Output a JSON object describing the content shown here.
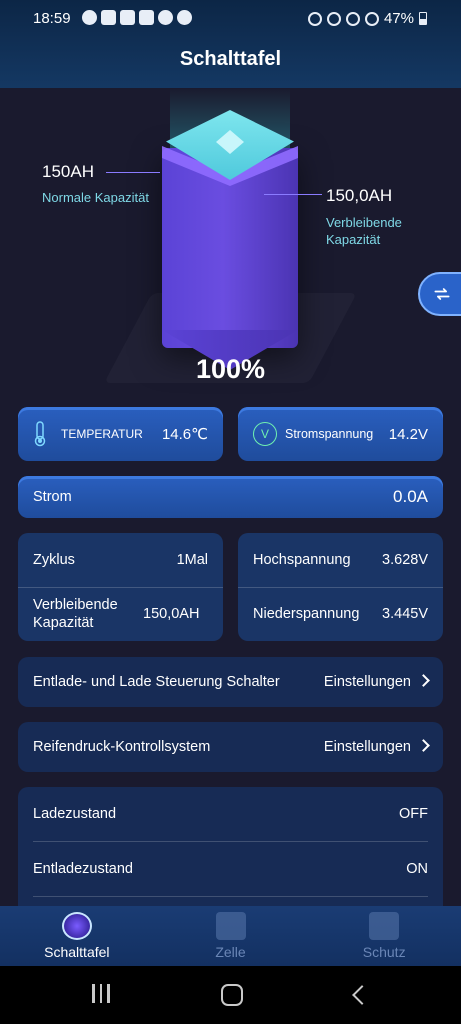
{
  "status_bar": {
    "time": "18:59",
    "battery_percent": "47%",
    "icons": [
      "whatsapp-icon",
      "youtube-icon",
      "mail-icon",
      "youtube-icon",
      "triangle-icon",
      "triangle-icon",
      "alarm-icon",
      "mute-icon",
      "wifi-icon",
      "signal-icon"
    ]
  },
  "header": {
    "title": "Schalttafel"
  },
  "battery_visual": {
    "normal_capacity_value": "150AH",
    "normal_capacity_label": "Normale Kapazität",
    "remaining_capacity_value": "150,0AH",
    "remaining_capacity_label": "Verbleibende Kapazität",
    "percent": "100%"
  },
  "metrics": {
    "temperature_label": "TEMPERATUR",
    "temperature_value": "14.6℃",
    "voltage_label": "Stromspannung",
    "voltage_value": "14.2V",
    "current_label": "Strom",
    "current_value": "0.0A"
  },
  "stats": {
    "cycle_label": "Zyklus",
    "cycle_value": "1Mal",
    "remaining_label": "Verbleibende Kapazität",
    "remaining_value": "150,0AH",
    "high_voltage_label": "Hochspannung",
    "high_voltage_value": "3.628V",
    "low_voltage_label": "Niederspannung",
    "low_voltage_value": "3.445V"
  },
  "settings": {
    "discharge_charge_label": "Entlade- und Lade Steuerung Schalter",
    "discharge_charge_action": "Einstellungen",
    "tire_pressure_label": "Reifendruck-Kontrollsystem",
    "tire_pressure_action": "Einstellungen"
  },
  "states": {
    "charge_label": "Ladezustand",
    "charge_value": "OFF",
    "discharge_label": "Entladezustand",
    "discharge_value": "ON"
  },
  "bottom_nav": {
    "items": [
      {
        "label": "Schalttafel",
        "icon": "battery-cube-icon",
        "active": true
      },
      {
        "label": "Zelle",
        "icon": "cell-chip-icon",
        "active": false
      },
      {
        "label": "Schutz",
        "icon": "warning-shield-icon",
        "active": false
      }
    ]
  }
}
